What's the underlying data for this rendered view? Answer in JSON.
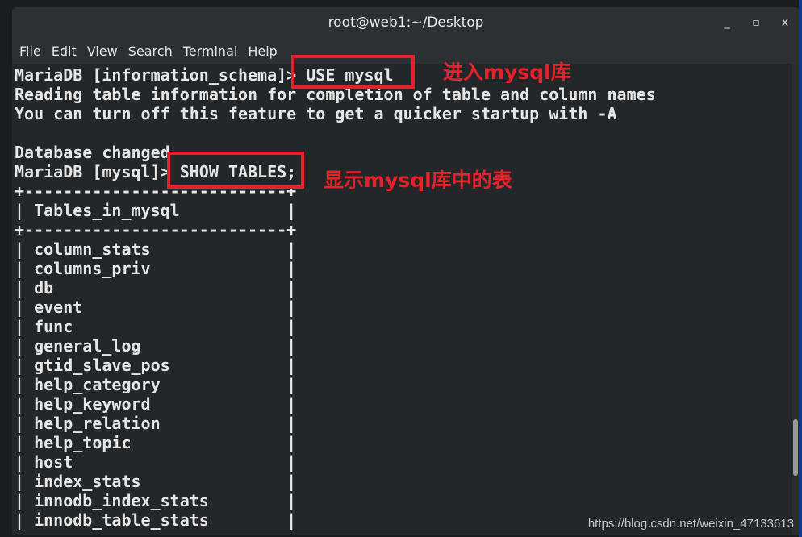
{
  "window": {
    "title": "root@web1:~/Desktop",
    "controls": [
      "_",
      "▫",
      "x"
    ]
  },
  "menu": [
    "File",
    "Edit",
    "View",
    "Search",
    "Terminal",
    "Help"
  ],
  "terminal": {
    "lines": [
      "MariaDB [information_schema]> USE mysql",
      "Reading table information for completion of table and column names",
      "You can turn off this feature to get a quicker startup with -A",
      "",
      "Database changed",
      "MariaDB [mysql]> SHOW TABLES;",
      "+---------------------------+",
      "| Tables_in_mysql           |",
      "+---------------------------+",
      "| column_stats              |",
      "| columns_priv              |",
      "| db                        |",
      "| event                     |",
      "| func                      |",
      "| general_log               |",
      "| gtid_slave_pos            |",
      "| help_category             |",
      "| help_keyword              |",
      "| help_relation             |",
      "| help_topic                |",
      "| host                      |",
      "| index_stats               |",
      "| innodb_index_stats        |",
      "| innodb_table_stats        |"
    ]
  },
  "annotations": {
    "use_note": "进入mysql库",
    "show_note": "显示mysql库中的表",
    "color": "#e8202a"
  },
  "watermark": "https://blog.csdn.net/weixin_47133613"
}
